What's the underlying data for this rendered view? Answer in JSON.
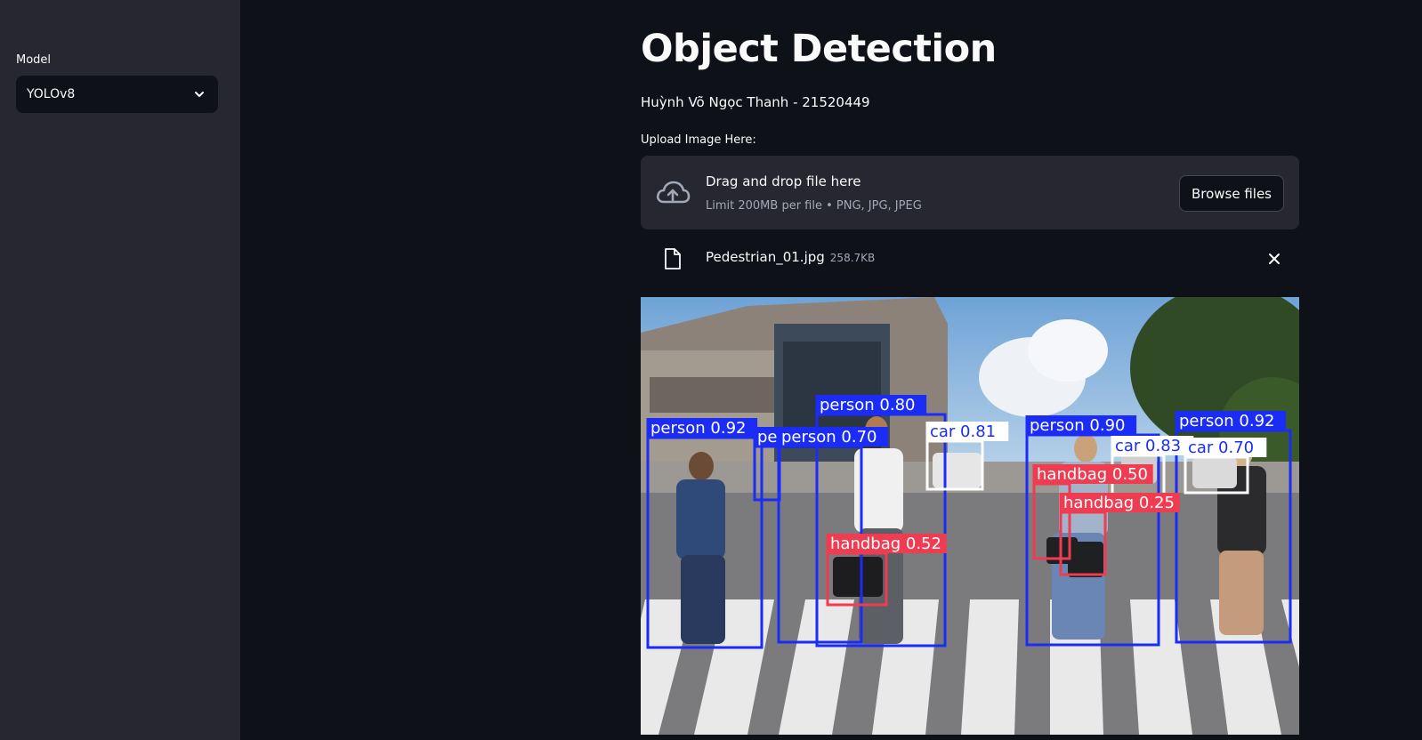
{
  "sidebar": {
    "model_label": "Model",
    "model_selected": "YOLOv8"
  },
  "main": {
    "title": "Object Detection",
    "subtitle": "Huỳnh Võ Ngọc Thanh - 21520449",
    "upload_label": "Upload Image Here:",
    "dropzone": {
      "title": "Drag and drop file here",
      "limit": "Limit 200MB per file • PNG, JPG, JPEG",
      "browse_label": "Browse files"
    },
    "file": {
      "name": "Pedestrian_01.jpg",
      "size": "258.7KB"
    }
  },
  "detections": [
    {
      "label": "person 0.92",
      "class": "person"
    },
    {
      "label": "person 0.80",
      "class": "person"
    },
    {
      "label": "person 0.70",
      "class": "person"
    },
    {
      "label": "pe",
      "class": "person"
    },
    {
      "label": "person 0.90",
      "class": "person"
    },
    {
      "label": "person 0.92",
      "class": "person"
    },
    {
      "label": "car 0.81",
      "class": "car"
    },
    {
      "label": "car 0.83",
      "class": "car"
    },
    {
      "label": "car 0.70",
      "class": "car"
    },
    {
      "label": "handbag 0.52",
      "class": "handbag"
    },
    {
      "label": "handbag 0.50",
      "class": "handbag"
    },
    {
      "label": "handbag 0.25",
      "class": "handbag"
    }
  ],
  "colors": {
    "person": "#1a2cf5",
    "car": "#ffffff",
    "handbag": "#ef3c50",
    "accent": "#ff4b4b"
  },
  "icons": {
    "dropdown": "chevron-down-icon",
    "upload": "cloud-upload-icon",
    "file": "file-icon",
    "close": "close-icon"
  }
}
